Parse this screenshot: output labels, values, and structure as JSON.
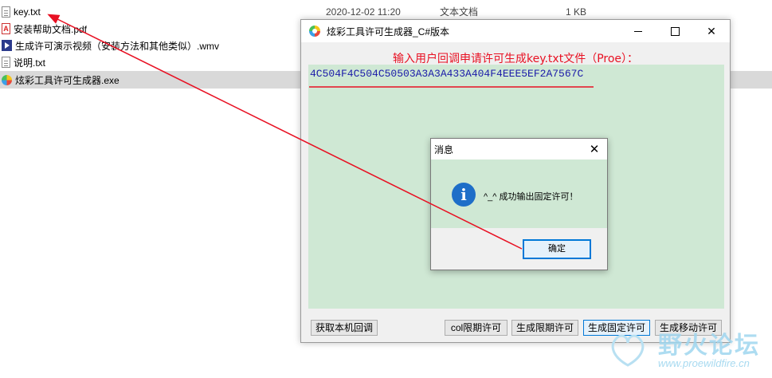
{
  "explorer": {
    "files": [
      {
        "name": "key.txt",
        "icon": "text-file-icon"
      },
      {
        "name": "安装帮助文档.pdf",
        "icon": "pdf-file-icon"
      },
      {
        "name": "生成许可演示视频（安装方法和其他类似）.wmv",
        "icon": "video-file-icon"
      },
      {
        "name": "说明.txt",
        "icon": "text-file-icon"
      },
      {
        "name": "炫彩工具许可生成器.exe",
        "icon": "app-exe-icon"
      }
    ],
    "first_row_date": "2020-12-02 11:20",
    "first_row_type": "文本文档",
    "first_row_size": "1 KB"
  },
  "window": {
    "title": "炫彩工具许可生成器_C#版本",
    "prompt": "输入用户回调申请许可生成key.txt文件（Proe）：",
    "license_code": "4C504F4C504C50503A3A3A433A404F4EEE5EF2A7567C",
    "buttons": {
      "get_callback": "获取本机回调",
      "col_license": "col限期许可",
      "gen_limited": "生成限期许可",
      "gen_fixed": "生成固定许可",
      "gen_mobile": "生成移动许可"
    }
  },
  "dialog": {
    "title": "消息",
    "message": "^_^ 成功输出固定许可！",
    "ok_label": "确定"
  },
  "watermark": {
    "text": "野火论坛",
    "url": "www.proewildfire.cn"
  },
  "colors": {
    "annotation": "#e81123",
    "license_bg": "#cfe8d4",
    "code_text": "#1a1aa8",
    "accent": "#0078d7"
  }
}
